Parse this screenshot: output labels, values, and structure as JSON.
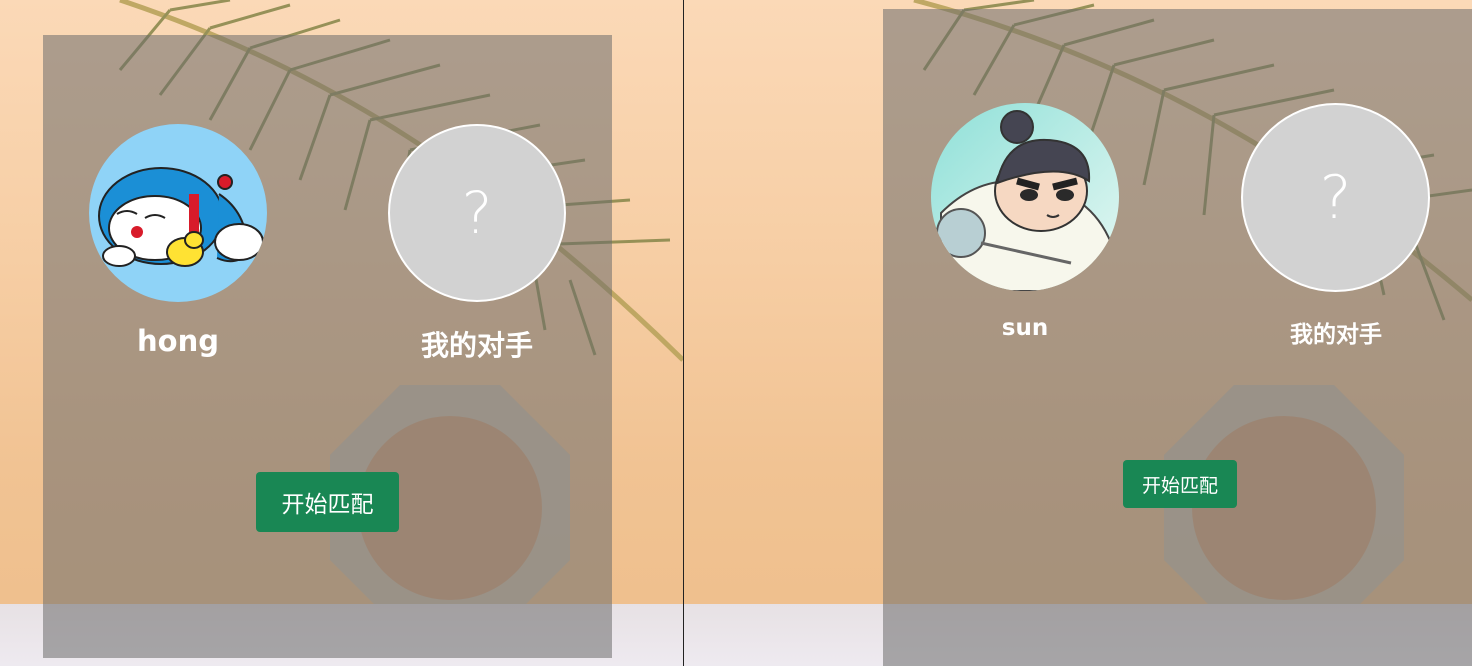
{
  "left_view": {
    "player": {
      "name": "hong",
      "avatar_icon": "doraemon-avatar"
    },
    "opponent": {
      "name": "我的对手",
      "placeholder": "?"
    },
    "match_button": {
      "label": "开始匹配"
    }
  },
  "right_view": {
    "player": {
      "name": "sun",
      "avatar_icon": "cartoon-boy-avatar"
    },
    "opponent": {
      "name": "我的对手",
      "placeholder": "?"
    },
    "match_button": {
      "label": "开始匹配"
    }
  },
  "colors": {
    "panel_overlay": "rgba(108,108,108,0.55)",
    "button": "#198754",
    "opponent_avatar": "#d2d2d2",
    "background": "#f7d3ae"
  }
}
